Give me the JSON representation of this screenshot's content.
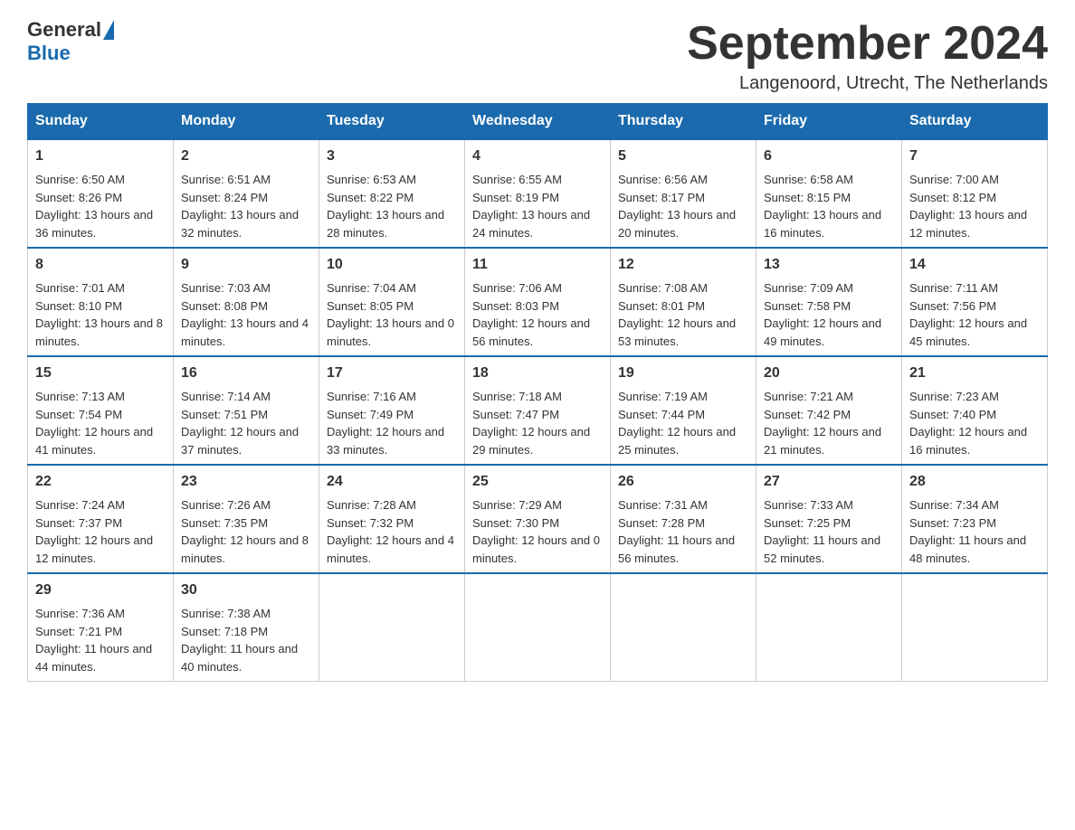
{
  "logo": {
    "general": "General",
    "blue": "Blue"
  },
  "title": "September 2024",
  "location": "Langenoord, Utrecht, The Netherlands",
  "days_of_week": [
    "Sunday",
    "Monday",
    "Tuesday",
    "Wednesday",
    "Thursday",
    "Friday",
    "Saturday"
  ],
  "weeks": [
    [
      {
        "day": "1",
        "sunrise": "Sunrise: 6:50 AM",
        "sunset": "Sunset: 8:26 PM",
        "daylight": "Daylight: 13 hours and 36 minutes."
      },
      {
        "day": "2",
        "sunrise": "Sunrise: 6:51 AM",
        "sunset": "Sunset: 8:24 PM",
        "daylight": "Daylight: 13 hours and 32 minutes."
      },
      {
        "day": "3",
        "sunrise": "Sunrise: 6:53 AM",
        "sunset": "Sunset: 8:22 PM",
        "daylight": "Daylight: 13 hours and 28 minutes."
      },
      {
        "day": "4",
        "sunrise": "Sunrise: 6:55 AM",
        "sunset": "Sunset: 8:19 PM",
        "daylight": "Daylight: 13 hours and 24 minutes."
      },
      {
        "day": "5",
        "sunrise": "Sunrise: 6:56 AM",
        "sunset": "Sunset: 8:17 PM",
        "daylight": "Daylight: 13 hours and 20 minutes."
      },
      {
        "day": "6",
        "sunrise": "Sunrise: 6:58 AM",
        "sunset": "Sunset: 8:15 PM",
        "daylight": "Daylight: 13 hours and 16 minutes."
      },
      {
        "day": "7",
        "sunrise": "Sunrise: 7:00 AM",
        "sunset": "Sunset: 8:12 PM",
        "daylight": "Daylight: 13 hours and 12 minutes."
      }
    ],
    [
      {
        "day": "8",
        "sunrise": "Sunrise: 7:01 AM",
        "sunset": "Sunset: 8:10 PM",
        "daylight": "Daylight: 13 hours and 8 minutes."
      },
      {
        "day": "9",
        "sunrise": "Sunrise: 7:03 AM",
        "sunset": "Sunset: 8:08 PM",
        "daylight": "Daylight: 13 hours and 4 minutes."
      },
      {
        "day": "10",
        "sunrise": "Sunrise: 7:04 AM",
        "sunset": "Sunset: 8:05 PM",
        "daylight": "Daylight: 13 hours and 0 minutes."
      },
      {
        "day": "11",
        "sunrise": "Sunrise: 7:06 AM",
        "sunset": "Sunset: 8:03 PM",
        "daylight": "Daylight: 12 hours and 56 minutes."
      },
      {
        "day": "12",
        "sunrise": "Sunrise: 7:08 AM",
        "sunset": "Sunset: 8:01 PM",
        "daylight": "Daylight: 12 hours and 53 minutes."
      },
      {
        "day": "13",
        "sunrise": "Sunrise: 7:09 AM",
        "sunset": "Sunset: 7:58 PM",
        "daylight": "Daylight: 12 hours and 49 minutes."
      },
      {
        "day": "14",
        "sunrise": "Sunrise: 7:11 AM",
        "sunset": "Sunset: 7:56 PM",
        "daylight": "Daylight: 12 hours and 45 minutes."
      }
    ],
    [
      {
        "day": "15",
        "sunrise": "Sunrise: 7:13 AM",
        "sunset": "Sunset: 7:54 PM",
        "daylight": "Daylight: 12 hours and 41 minutes."
      },
      {
        "day": "16",
        "sunrise": "Sunrise: 7:14 AM",
        "sunset": "Sunset: 7:51 PM",
        "daylight": "Daylight: 12 hours and 37 minutes."
      },
      {
        "day": "17",
        "sunrise": "Sunrise: 7:16 AM",
        "sunset": "Sunset: 7:49 PM",
        "daylight": "Daylight: 12 hours and 33 minutes."
      },
      {
        "day": "18",
        "sunrise": "Sunrise: 7:18 AM",
        "sunset": "Sunset: 7:47 PM",
        "daylight": "Daylight: 12 hours and 29 minutes."
      },
      {
        "day": "19",
        "sunrise": "Sunrise: 7:19 AM",
        "sunset": "Sunset: 7:44 PM",
        "daylight": "Daylight: 12 hours and 25 minutes."
      },
      {
        "day": "20",
        "sunrise": "Sunrise: 7:21 AM",
        "sunset": "Sunset: 7:42 PM",
        "daylight": "Daylight: 12 hours and 21 minutes."
      },
      {
        "day": "21",
        "sunrise": "Sunrise: 7:23 AM",
        "sunset": "Sunset: 7:40 PM",
        "daylight": "Daylight: 12 hours and 16 minutes."
      }
    ],
    [
      {
        "day": "22",
        "sunrise": "Sunrise: 7:24 AM",
        "sunset": "Sunset: 7:37 PM",
        "daylight": "Daylight: 12 hours and 12 minutes."
      },
      {
        "day": "23",
        "sunrise": "Sunrise: 7:26 AM",
        "sunset": "Sunset: 7:35 PM",
        "daylight": "Daylight: 12 hours and 8 minutes."
      },
      {
        "day": "24",
        "sunrise": "Sunrise: 7:28 AM",
        "sunset": "Sunset: 7:32 PM",
        "daylight": "Daylight: 12 hours and 4 minutes."
      },
      {
        "day": "25",
        "sunrise": "Sunrise: 7:29 AM",
        "sunset": "Sunset: 7:30 PM",
        "daylight": "Daylight: 12 hours and 0 minutes."
      },
      {
        "day": "26",
        "sunrise": "Sunrise: 7:31 AM",
        "sunset": "Sunset: 7:28 PM",
        "daylight": "Daylight: 11 hours and 56 minutes."
      },
      {
        "day": "27",
        "sunrise": "Sunrise: 7:33 AM",
        "sunset": "Sunset: 7:25 PM",
        "daylight": "Daylight: 11 hours and 52 minutes."
      },
      {
        "day": "28",
        "sunrise": "Sunrise: 7:34 AM",
        "sunset": "Sunset: 7:23 PM",
        "daylight": "Daylight: 11 hours and 48 minutes."
      }
    ],
    [
      {
        "day": "29",
        "sunrise": "Sunrise: 7:36 AM",
        "sunset": "Sunset: 7:21 PM",
        "daylight": "Daylight: 11 hours and 44 minutes."
      },
      {
        "day": "30",
        "sunrise": "Sunrise: 7:38 AM",
        "sunset": "Sunset: 7:18 PM",
        "daylight": "Daylight: 11 hours and 40 minutes."
      },
      null,
      null,
      null,
      null,
      null
    ]
  ]
}
